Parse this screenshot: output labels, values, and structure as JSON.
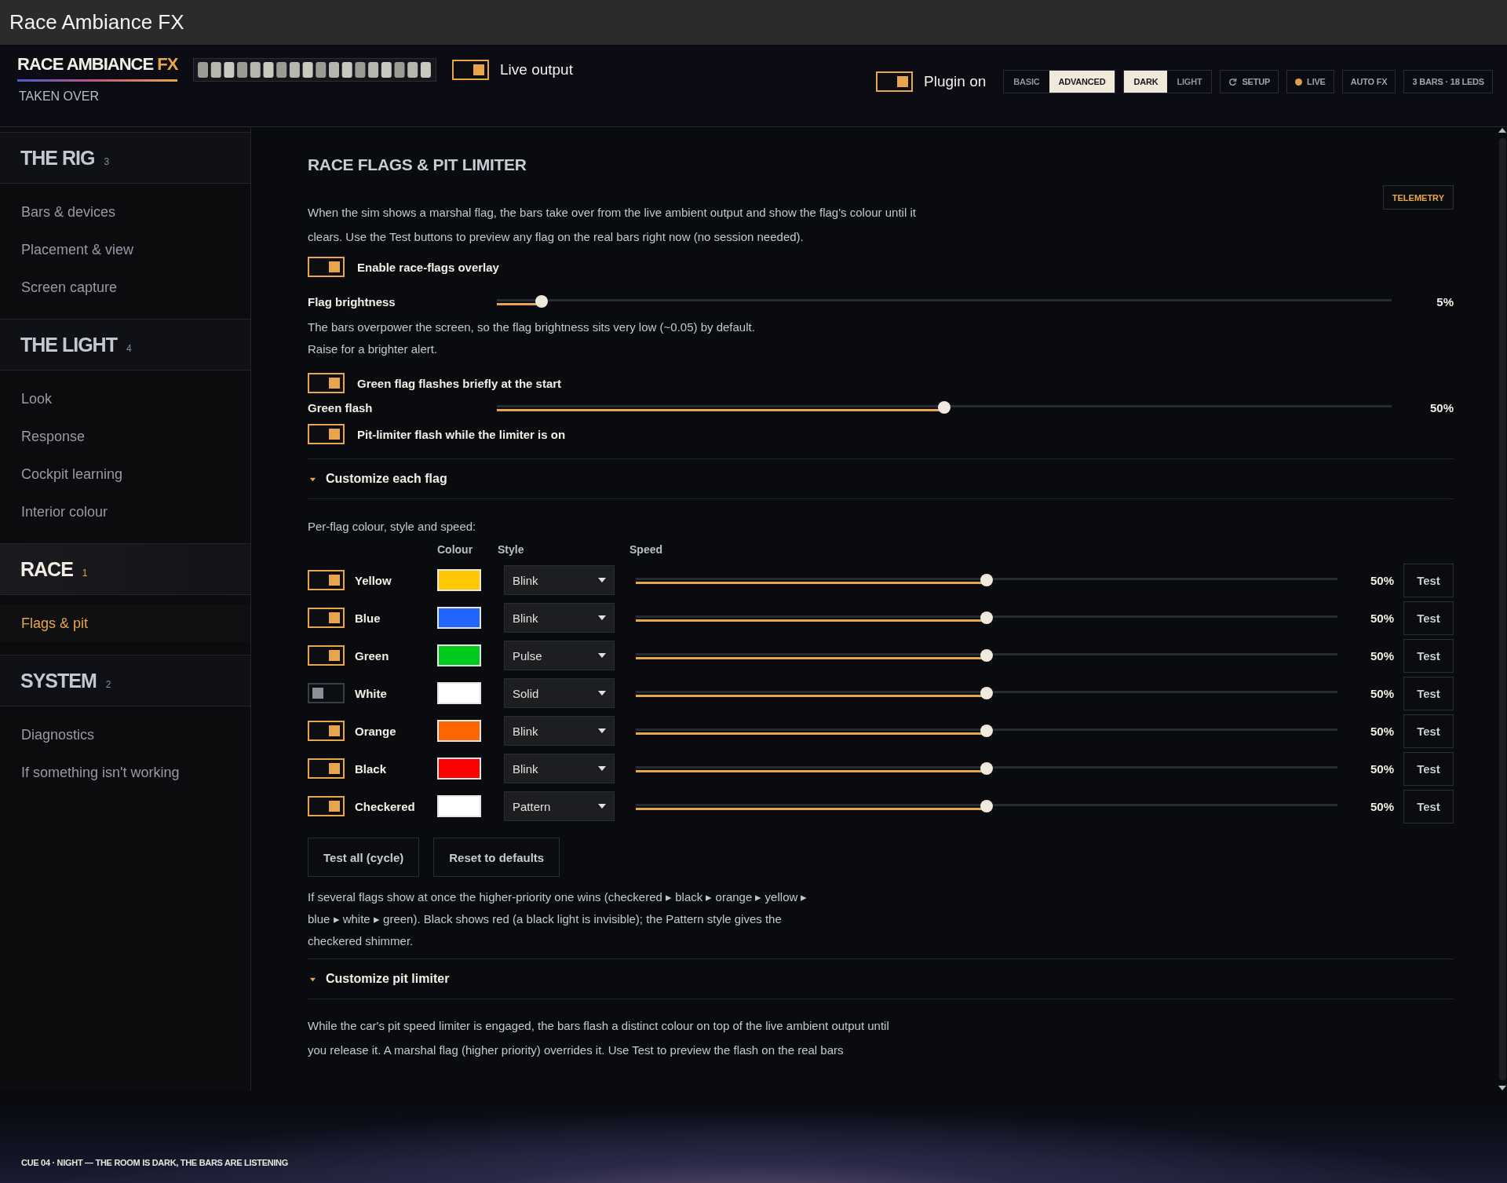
{
  "window": {
    "title": "Race Ambiance FX"
  },
  "header": {
    "logo": "RACE AMBIANCE",
    "logo_accent": "FX",
    "status": "TAKEN OVER",
    "live_output": {
      "label": "Live output",
      "on": true
    },
    "plugin": {
      "label": "Plugin on",
      "on": true
    },
    "mode_tabs": [
      {
        "label": "BASIC",
        "selected": false
      },
      {
        "label": "ADVANCED",
        "selected": true
      }
    ],
    "theme_tabs": [
      {
        "label": "DARK",
        "selected": true
      },
      {
        "label": "LIGHT",
        "selected": false
      }
    ],
    "buttons": [
      {
        "kind": "setup",
        "label": "SETUP"
      },
      {
        "kind": "live",
        "label": "LIVE"
      },
      {
        "kind": "plain",
        "label": "AUTO FX"
      },
      {
        "kind": "plain",
        "label": "3 BARS · 18 LEDS"
      }
    ]
  },
  "sidebar": {
    "sections": [
      {
        "title": "THE RIG",
        "count": "3",
        "selected": false,
        "items": [
          {
            "label": "Bars & devices",
            "selected": false
          },
          {
            "label": "Placement & view",
            "selected": false
          },
          {
            "label": "Screen capture",
            "selected": false
          }
        ]
      },
      {
        "title": "THE LIGHT",
        "count": "4",
        "selected": false,
        "items": [
          {
            "label": "Look",
            "selected": false
          },
          {
            "label": "Response",
            "selected": false
          },
          {
            "label": "Cockpit learning",
            "selected": false
          },
          {
            "label": "Interior colour",
            "selected": false
          }
        ]
      },
      {
        "title": "RACE",
        "count": "1",
        "selected": true,
        "items": [
          {
            "label": "Flags & pit",
            "selected": true
          }
        ]
      },
      {
        "title": "SYSTEM",
        "count": "2",
        "selected": false,
        "items": [
          {
            "label": "Diagnostics",
            "selected": false
          },
          {
            "label": "If something isn't working",
            "selected": false
          }
        ]
      }
    ]
  },
  "content": {
    "title": "RACE FLAGS & PIT LIMITER",
    "telemetry": "TELEMETRY",
    "intro": "When the sim shows a marshal flag, the bars take over from the live ambient output and show the flag's colour until it clears. Use the Test buttons to preview any flag on the real bars right now (no session needed).",
    "enable_overlay": {
      "label": "Enable race-flags overlay",
      "on": true
    },
    "flag_brightness": {
      "label": "Flag brightness",
      "level": 0.05,
      "reading": "5%"
    },
    "brightness_note": "The bars overpower the screen, so the flag brightness sits very low (~0.05) by default. Raise for a brighter alert.",
    "green_start": {
      "label": "Green flag flashes briefly at the start",
      "on": true
    },
    "green_flash": {
      "label": "Green flash",
      "level": 0.5,
      "reading": "50%"
    },
    "pit_flash": {
      "label": "Pit-limiter flash while the limiter is on",
      "on": true
    },
    "flags_section": {
      "title": "Customize each flag",
      "expanded": true,
      "caption": "Per-flag colour, style and speed:",
      "columns": [
        "Colour",
        "Style",
        "Speed"
      ],
      "rows": [
        {
          "name": "Yellow",
          "on": true,
          "color": "#ffc800",
          "style": "Blink",
          "level": 0.5,
          "reading": "50%",
          "test": "Test"
        },
        {
          "name": "Blue",
          "on": true,
          "color": "#2266ff",
          "style": "Blink",
          "level": 0.5,
          "reading": "50%",
          "test": "Test"
        },
        {
          "name": "Green",
          "on": true,
          "color": "#00cc1e",
          "style": "Pulse",
          "level": 0.5,
          "reading": "50%",
          "test": "Test"
        },
        {
          "name": "White",
          "on": false,
          "color": "#ffffff",
          "style": "Solid",
          "level": 0.5,
          "reading": "50%",
          "test": "Test"
        },
        {
          "name": "Orange",
          "on": true,
          "color": "#ff6600",
          "style": "Blink",
          "level": 0.5,
          "reading": "50%",
          "test": "Test"
        },
        {
          "name": "Black",
          "on": true,
          "color": "#ff0000",
          "style": "Blink",
          "level": 0.5,
          "reading": "50%",
          "test": "Test"
        },
        {
          "name": "Checkered",
          "on": true,
          "color": "#ffffff",
          "style": "Pattern",
          "level": 0.5,
          "reading": "50%",
          "test": "Test"
        }
      ],
      "buttons": [
        "Test all (cycle)",
        "Reset to defaults"
      ],
      "note": "If several flags show at once the higher-priority one wins (checkered ▸ black ▸ orange ▸ yellow ▸ blue ▸ white ▸ green). Black shows red (a black light is invisible); the Pattern style gives the checkered shimmer."
    },
    "pit_section": {
      "title": "Customize pit limiter",
      "expanded": true,
      "text": "While the car's pit speed limiter is engaged, the bars flash a distinct colour on top of the live ambient output until you release it. A marshal flag (higher priority) overrides it. Use Test to preview the flash on the real bars"
    }
  },
  "footer": "CUE 04 · NIGHT — THE ROOM IS DARK, THE BARS ARE LISTENING"
}
